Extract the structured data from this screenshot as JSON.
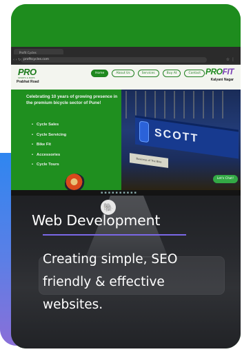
{
  "colors": {
    "card_green": "#1f8a1f",
    "accent_line": "#7b68e8",
    "blob_blue": "#2f86f0"
  },
  "browser": {
    "tab_label": "Profit Cycles",
    "url": "profitcycles.com",
    "nav_glyphs": "‹ › ↻"
  },
  "site": {
    "logo_left": "PRO",
    "logo_left_sub": "SPORTS & BIKES",
    "logo_left_caption": "Prabhat Road",
    "menu": [
      "Home",
      "About Us",
      "Services",
      "Buy At",
      "Contact"
    ],
    "logo_right_a": "PRO",
    "logo_right_b": "FIT",
    "logo_right_caption": "Kalyani Nagar"
  },
  "hero": {
    "heading": "Celebrating 10 years of growing presence in the premium bicycle sector of Pune!",
    "list": [
      "Cycle Sales",
      "Cycle Servicing",
      "Bike Fit",
      "Accessories",
      "Cycle Tours"
    ],
    "store_sign": "SCOTT",
    "plate_text": "Business of The Bike",
    "chat_label": "Let's Chat!"
  },
  "card": {
    "title": "Web Development",
    "description": "Creating simple, SEO friendly & effective websites."
  }
}
